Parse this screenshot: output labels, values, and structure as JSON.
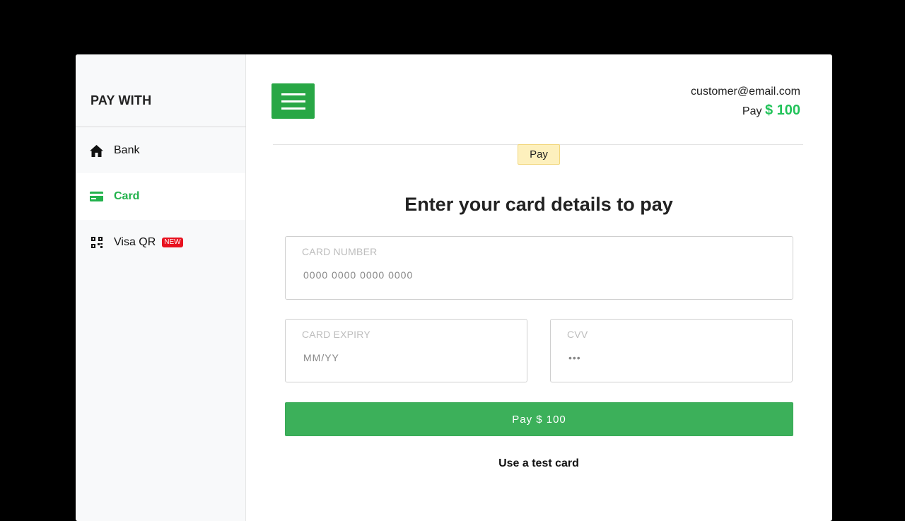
{
  "sidebar": {
    "title": "PAY WITH",
    "items": [
      {
        "label": "Bank",
        "icon": "home-icon"
      },
      {
        "label": "Card",
        "icon": "card-icon",
        "active": true
      },
      {
        "label": "Visa QR",
        "icon": "qr-icon",
        "badge": "NEW"
      }
    ]
  },
  "header": {
    "email": "customer@email.com",
    "pay_prefix": "Pay",
    "amount": "$ 100"
  },
  "tag": "Pay",
  "heading": "Enter your card details to pay",
  "fields": {
    "card_number": {
      "label": "CARD NUMBER",
      "placeholder": "0000 0000 0000 0000"
    },
    "expiry": {
      "label": "CARD EXPIRY",
      "placeholder": "MM/YY"
    },
    "cvv": {
      "label": "CVV",
      "placeholder": "•••"
    }
  },
  "pay_button": "Pay $ 100",
  "test_card_link": "Use a test card",
  "colors": {
    "accent": "#22c35a",
    "button": "#3cb05a",
    "menu": "#28a745",
    "badge": "#e8121f"
  }
}
